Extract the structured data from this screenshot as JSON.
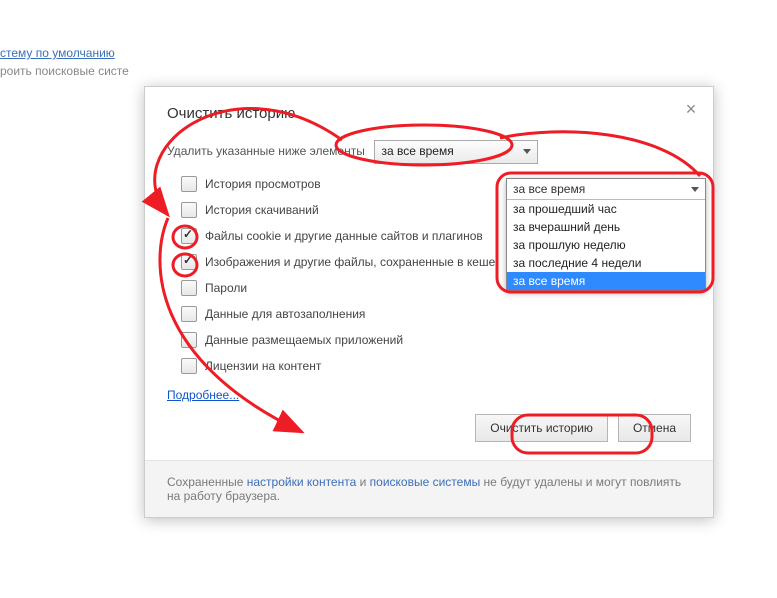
{
  "background": {
    "link1": "стему по умолчанию",
    "link2": "роить поисковые систе"
  },
  "dialog": {
    "title": "Очистить историю",
    "prompt": "Удалить указанные ниже элементы",
    "time_selected": "за все время",
    "options": [
      {
        "label": "История просмотров",
        "checked": false
      },
      {
        "label": "История скачиваний",
        "checked": false
      },
      {
        "label": "Файлы cookie и другие данные сайтов и плагинов",
        "checked": true
      },
      {
        "label": "Изображения и другие файлы, сохраненные в кеше",
        "checked": true
      },
      {
        "label": "Пароли",
        "checked": false
      },
      {
        "label": "Данные для автозаполнения",
        "checked": false
      },
      {
        "label": "Данные размещаемых приложений",
        "checked": false
      },
      {
        "label": "Лицензии на контент",
        "checked": false
      }
    ],
    "more": "Подробнее...",
    "buttons": {
      "clear": "Очистить историю",
      "cancel": "Отмена"
    },
    "footer": {
      "pre": "Сохраненные ",
      "link1": "настройки контента",
      "mid": " и ",
      "link2": "поисковые системы",
      "post": " не будут удалены и могут повлиять на работу браузера."
    }
  },
  "dropdown": {
    "head": "за все время",
    "items": [
      {
        "label": "за прошедший час",
        "selected": false
      },
      {
        "label": "за вчерашний день",
        "selected": false
      },
      {
        "label": "за прошлую неделю",
        "selected": false
      },
      {
        "label": "за последние 4 недели",
        "selected": false
      },
      {
        "label": "за все время",
        "selected": true
      }
    ]
  },
  "annot": {
    "color": "#ee1c25"
  }
}
